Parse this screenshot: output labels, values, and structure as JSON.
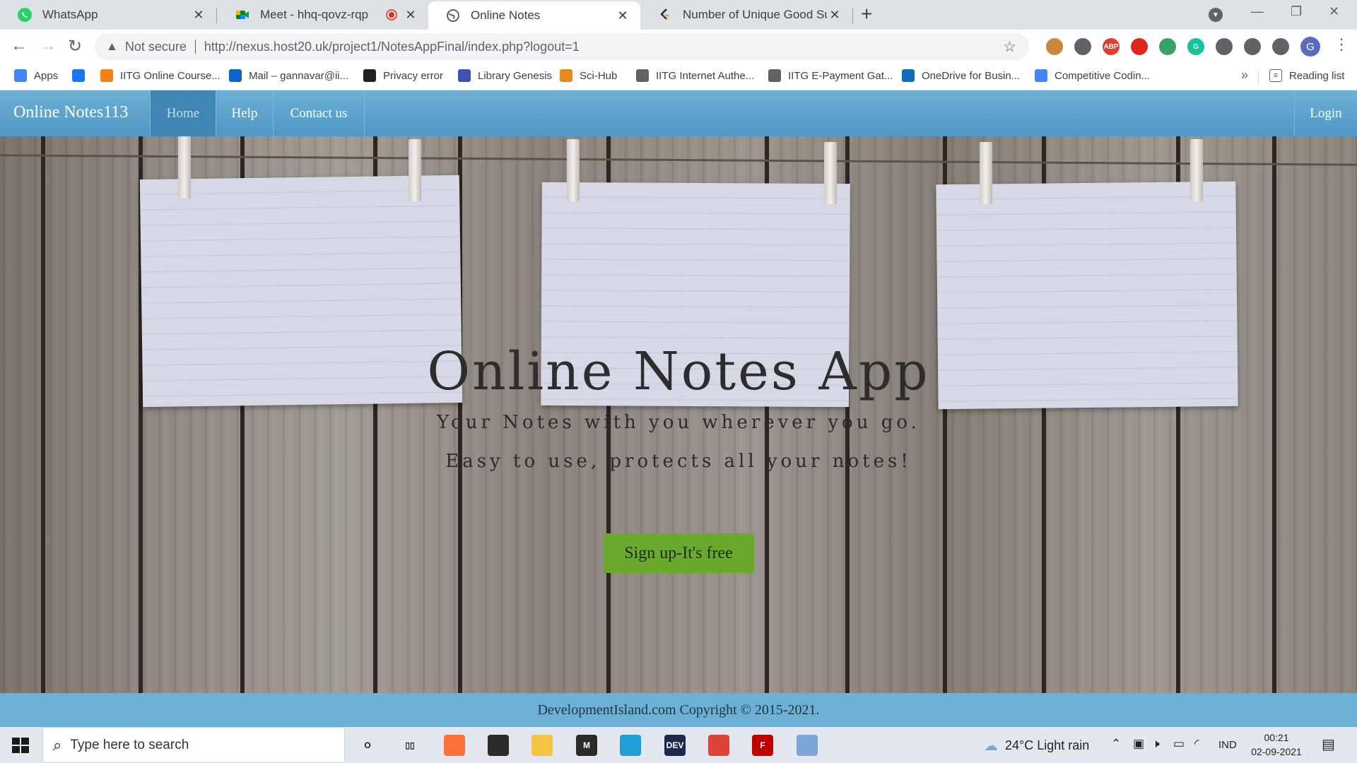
{
  "browser": {
    "tabs": [
      {
        "title": "WhatsApp",
        "icon": "whatsapp-icon"
      },
      {
        "title": "Meet - hhq-qovz-rqp",
        "icon": "google-meet-icon"
      },
      {
        "title": "Online Notes",
        "icon": "globe-icon"
      },
      {
        "title": "Number of Unique Good Subseq",
        "icon": "leetcode-icon"
      }
    ],
    "close_glyph": "✕",
    "new_tab_glyph": "+",
    "address": {
      "security_label": "Not secure",
      "url": "http://nexus.host20.uk/project1/NotesAppFinal/index.php?logout=1"
    },
    "profile_initial": "G",
    "extensions": [
      {
        "name": "cookie-icon",
        "color": "#c8893b",
        "label": ""
      },
      {
        "name": "glasses-icon",
        "color": "#5f6368",
        "label": ""
      },
      {
        "name": "adblock-icon",
        "color": "#e33b2e",
        "label": "ABP"
      },
      {
        "name": "stop-icon",
        "color": "#e0261b",
        "label": ""
      },
      {
        "name": "check-extension-icon",
        "color": "#38a169",
        "label": ""
      },
      {
        "name": "grammarly-icon",
        "color": "#15c39a",
        "label": "G"
      },
      {
        "name": "accessibility-icon",
        "color": "#5f6368",
        "label": ""
      },
      {
        "name": "pin-icon",
        "color": "#5f6368",
        "label": ""
      },
      {
        "name": "puzzle-icon",
        "color": "#5f6368",
        "label": ""
      }
    ],
    "bookmarks": [
      {
        "label": "Apps",
        "icon": "apps-grid-icon",
        "color": "#4285f4"
      },
      {
        "label": "",
        "icon": "facebook-icon",
        "color": "#1877f2"
      },
      {
        "label": "IITG Online Course...",
        "icon": "moodle-icon",
        "color": "#f98012"
      },
      {
        "label": "Mail – gannavar@ii...",
        "icon": "outlook-icon",
        "color": "#0a64c9"
      },
      {
        "label": "Privacy error",
        "icon": "warning-icon",
        "color": "#202124"
      },
      {
        "label": "Library Genesis",
        "icon": "book-icon",
        "color": "#3f51b5"
      },
      {
        "label": "Sci-Hub",
        "icon": "scihub-icon",
        "color": "#e88a1a"
      },
      {
        "label": "IITG Internet Authe...",
        "icon": "globe-icon",
        "color": "#5f6368"
      },
      {
        "label": "IITG E-Payment Gat...",
        "icon": "globe-icon",
        "color": "#5f6368"
      },
      {
        "label": "OneDrive for Busin...",
        "icon": "onedrive-icon",
        "color": "#0f6cbd"
      },
      {
        "label": "Competitive Codin...",
        "icon": "docs-icon",
        "color": "#4285f4"
      }
    ],
    "bookmarks_more": "»",
    "reading_list": "Reading list"
  },
  "site": {
    "brand": "Online Notes113",
    "nav": [
      {
        "label": "Home",
        "active": true
      },
      {
        "label": "Help",
        "active": false
      },
      {
        "label": "Contact us",
        "active": false
      }
    ],
    "login": "Login",
    "hero": {
      "title": "Online Notes App",
      "subtitle1": "Your Notes with you wherever you go.",
      "subtitle2": "Easy to use, protects all your notes!",
      "cta": "Sign up-It's free"
    },
    "footer": "DevelopmentIsland.com Copyright © 2015-2021."
  },
  "taskbar": {
    "search_placeholder": "Type here to search",
    "weather": "24°C  Light rain",
    "language": "IND",
    "time": "00:21",
    "date": "02-09-2021",
    "apps": [
      {
        "name": "cortana-icon",
        "color": "#e3e8ef",
        "label": "O"
      },
      {
        "name": "task-view-icon",
        "color": "#e3e8ef",
        "label": "▯▯"
      },
      {
        "name": "firefox-icon",
        "color": "#ff7139",
        "label": ""
      },
      {
        "name": "store-icon",
        "color": "#2b2b2b",
        "label": ""
      },
      {
        "name": "file-explorer-icon",
        "color": "#f6c445",
        "label": ""
      },
      {
        "name": "epic-icon",
        "color": "#2a2a2a",
        "label": "M"
      },
      {
        "name": "edge-icon",
        "color": "#1fa0d6",
        "label": ""
      },
      {
        "name": "dev-icon",
        "color": "#1b2a4a",
        "label": "DEV"
      },
      {
        "name": "chrome-icon",
        "color": "#db4437",
        "label": ""
      },
      {
        "name": "filezilla-icon",
        "color": "#bf0000",
        "label": "F"
      },
      {
        "name": "photos-icon",
        "color": "#7aa7d8",
        "label": ""
      }
    ]
  }
}
